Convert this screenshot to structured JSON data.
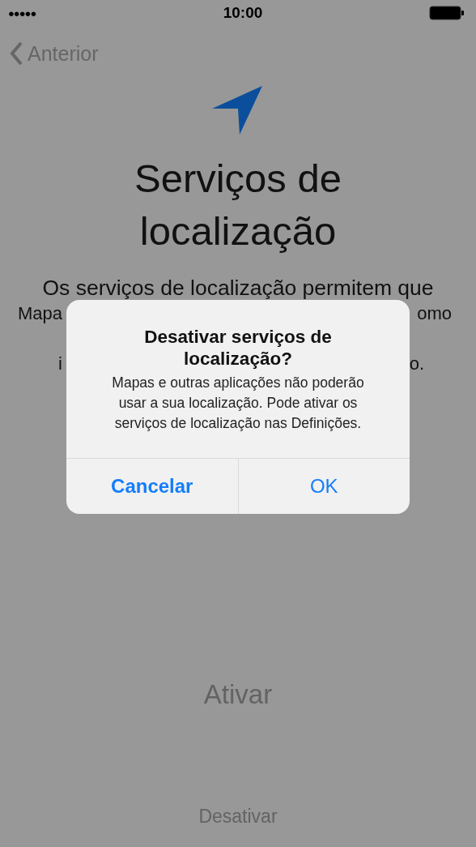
{
  "status_bar": {
    "signal_dots": "●●●●●",
    "time": "10:00"
  },
  "nav": {
    "back_label": "Anterior"
  },
  "title": "Serviços de localização",
  "description": {
    "line_1": "Os serviços de localização permitem que",
    "line_2_left": "Mapa",
    "line_2_right": "omo",
    "line_3_left": "i",
    "line_3_right": "o."
  },
  "dialog": {
    "title": "Desativar serviços de localização?",
    "message": "Mapas e outras aplicações não poderão usar a sua localização. Pode ativar os serviços de localização nas Definições.",
    "buttons": [
      {
        "label": "Cancelar",
        "kind": "cancel"
      },
      {
        "label": "OK",
        "kind": "default"
      }
    ]
  },
  "actions": [
    {
      "label": "Ativar",
      "kind": "primary"
    },
    {
      "label": "Desativar",
      "kind": "secondary"
    }
  ]
}
